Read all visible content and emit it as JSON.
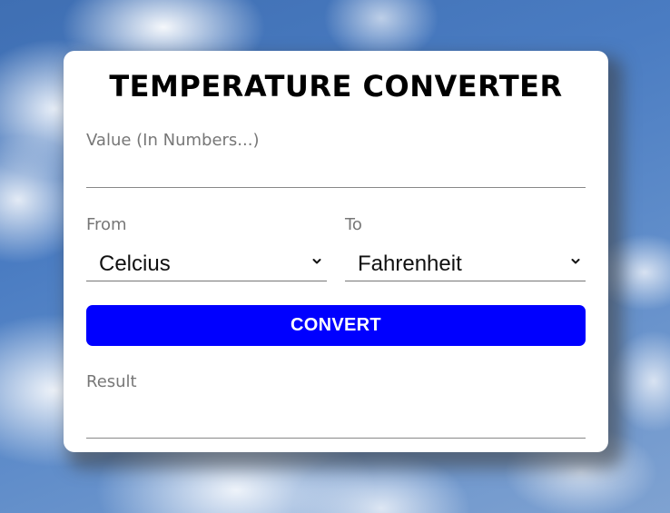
{
  "app": {
    "title": "TEMPERATURE CONVERTER"
  },
  "value_field": {
    "label": "Value (In Numbers...)",
    "value": ""
  },
  "from": {
    "label": "From",
    "selected": "Celcius"
  },
  "to": {
    "label": "To",
    "selected": "Fahrenheit"
  },
  "convert_button": {
    "label": "CONVERT"
  },
  "result": {
    "label": "Result",
    "value": ""
  },
  "colors": {
    "accent": "#0000ff",
    "card": "#ffffff"
  },
  "icons": {
    "dropdown": "chevron-down-icon"
  }
}
